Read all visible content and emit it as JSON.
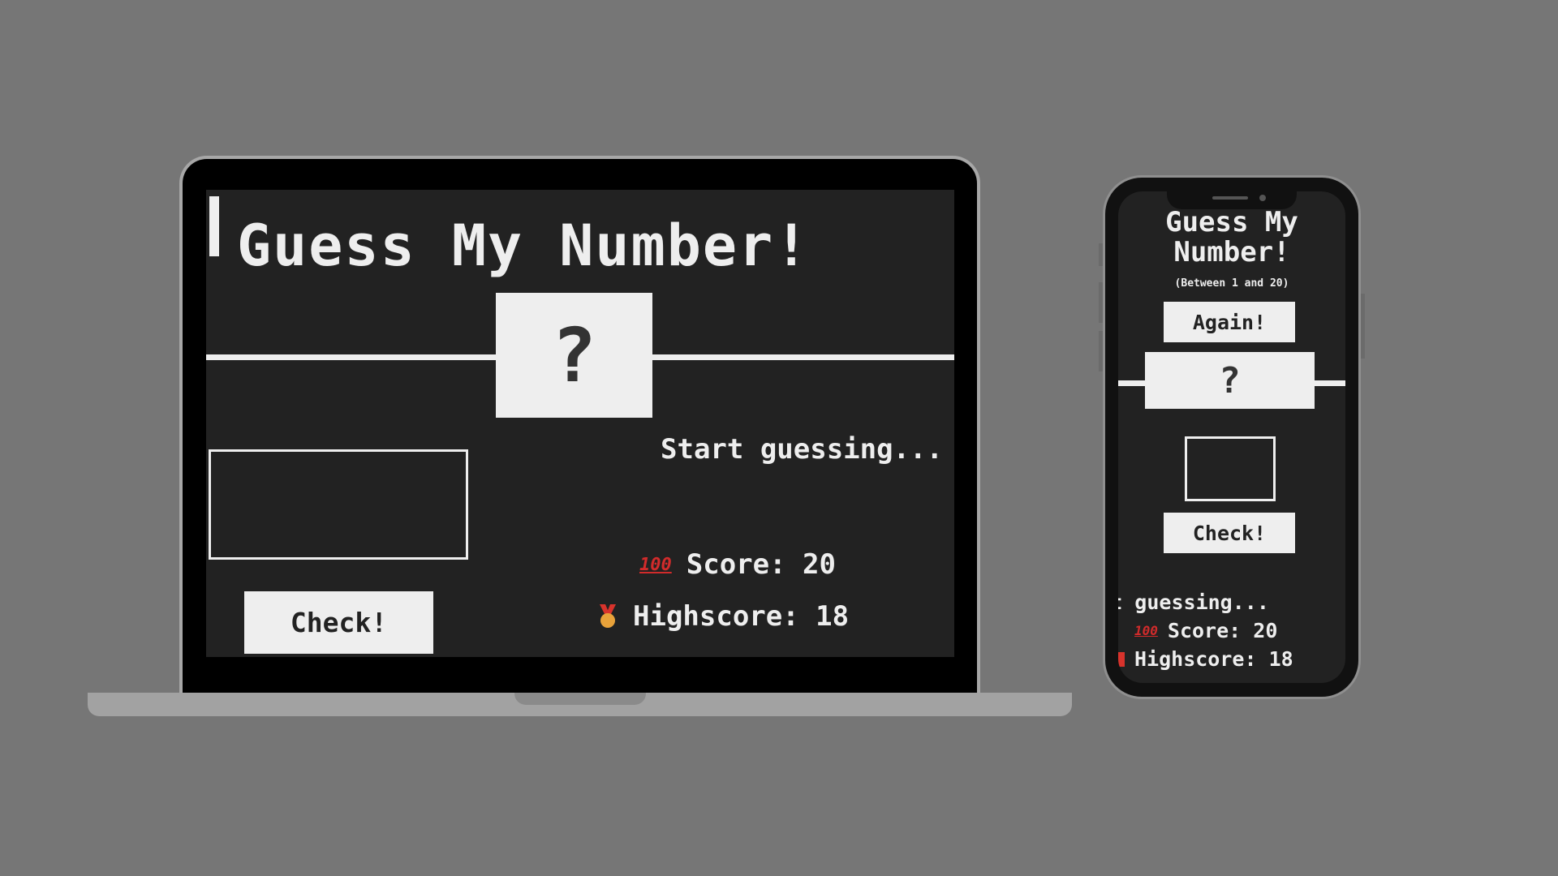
{
  "colors": {
    "background": "#767676",
    "screen": "#222222",
    "foreground": "#eeeeee",
    "score_icon": "#d22b2b",
    "medal_icon": "#e8a23a"
  },
  "laptop": {
    "title": "Guess My Number!",
    "secret_number": "?",
    "check_label": "Check!",
    "message": "Start guessing...",
    "score_icon": "100",
    "score_label": "Score: 20",
    "highscore_icon": "medal-icon",
    "highscore_label": "Highscore: 18"
  },
  "phone": {
    "title": "Guess My Number!",
    "subtitle": "(Between 1 and 20)",
    "again_label": "Again!",
    "secret_number": "?",
    "check_label": "Check!",
    "message": "Start guessing...",
    "score_icon": "100",
    "score_label": "Score: 20",
    "highscore_label": "Highscore: 18"
  }
}
